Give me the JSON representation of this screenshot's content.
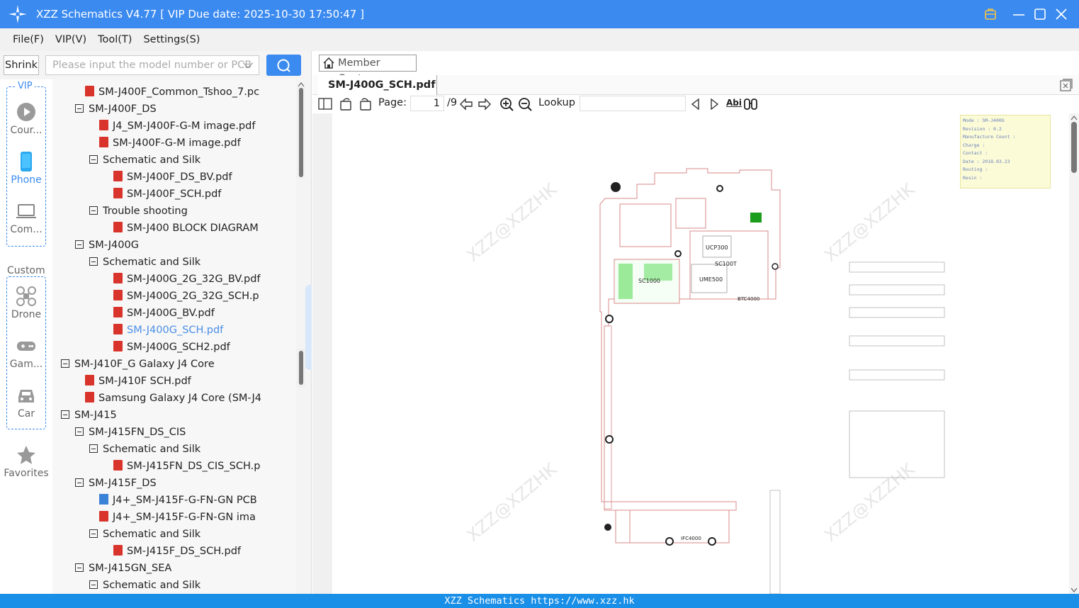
{
  "window": {
    "title": "XZZ Schematics V4.77 [ VIP Due date: 2025-10-30 17:50:47 ]"
  },
  "menu": [
    "File(F)",
    "VIP(V)",
    "Tool(T)",
    "Settings(S)"
  ],
  "left": {
    "shrink_label": "Shrink",
    "search_placeholder": "Please input the model number or PCB",
    "vip_label": "VIP",
    "custom_label": "Custom",
    "categories": [
      "Cour...",
      "Phone",
      "Com...",
      "Drone",
      "Gam...",
      "Car",
      "Favorites"
    ]
  },
  "tree": [
    {
      "label": "SM-J400F_Common_Tshoo_7.pc",
      "type": "pdf",
      "level": 1
    },
    {
      "label": "SM-J400F_DS",
      "type": "folder",
      "level": 1
    },
    {
      "label": "J4_SM-J400F-G-M image.pdf",
      "type": "pdf",
      "level": 2
    },
    {
      "label": "SM-J400F-G-M image.pdf",
      "type": "pdf",
      "level": 2
    },
    {
      "label": "Schematic and Silk",
      "type": "folder",
      "level": 2
    },
    {
      "label": "SM-J400F_DS_BV.pdf",
      "type": "pdf",
      "level": 3
    },
    {
      "label": "SM-J400F_SCH.pdf",
      "type": "pdf",
      "level": 3
    },
    {
      "label": "Trouble shooting",
      "type": "folder",
      "level": 2
    },
    {
      "label": "SM-J400 BLOCK DIAGRAM",
      "type": "pdf",
      "level": 3
    },
    {
      "label": "SM-J400G",
      "type": "folder",
      "level": 1
    },
    {
      "label": "Schematic and Silk",
      "type": "folder",
      "level": 2
    },
    {
      "label": "SM-J400G_2G_32G_BV.pdf",
      "type": "pdf",
      "level": 3
    },
    {
      "label": "SM-J400G_2G_32G_SCH.p",
      "type": "pdf",
      "level": 3
    },
    {
      "label": "SM-J400G_BV.pdf",
      "type": "pdf",
      "level": 3
    },
    {
      "label": "SM-J400G_SCH.pdf",
      "type": "pdf",
      "level": 3,
      "selected": true
    },
    {
      "label": "SM-J400G_SCH2.pdf",
      "type": "pdf",
      "level": 3
    },
    {
      "label": "SM-J410F_G Galaxy J4 Core",
      "type": "folder",
      "level": 0
    },
    {
      "label": "SM-J410F SCH.pdf",
      "type": "pdf",
      "level": 1
    },
    {
      "label": "Samsung Galaxy J4 Core (SM-J4",
      "type": "pdf",
      "level": 1
    },
    {
      "label": "SM-J415",
      "type": "folder",
      "level": 0
    },
    {
      "label": "SM-J415FN_DS_CIS",
      "type": "folder",
      "level": 1
    },
    {
      "label": "Schematic and Silk",
      "type": "folder",
      "level": 2
    },
    {
      "label": "SM-J415FN_DS_CIS_SCH.p",
      "type": "pdf",
      "level": 3
    },
    {
      "label": "SM-J415F_DS",
      "type": "folder",
      "level": 1
    },
    {
      "label": "J4+_SM-J415F-G-FN-GN PCB",
      "type": "pcb",
      "level": 2
    },
    {
      "label": "J4+_SM-J415F-G-FN-GN ima",
      "type": "pdf",
      "level": 2
    },
    {
      "label": "Schematic and Silk",
      "type": "folder",
      "level": 2
    },
    {
      "label": "SM-J415F_DS_SCH.pdf",
      "type": "pdf",
      "level": 3
    },
    {
      "label": "SM-J415GN_SEA",
      "type": "folder",
      "level": 1
    },
    {
      "label": "Schematic and Silk",
      "type": "folder",
      "level": 2
    }
  ],
  "right": {
    "member_center": "Member Center",
    "tab_title": "SM-J400G_SCH.pdf",
    "toolbar": {
      "page_label": "Page:",
      "page_value": "1",
      "page_total": "/9",
      "lookup_label": "Lookup",
      "abi": "Abi"
    },
    "info_box": [
      "Mode : SM-J400G",
      "Revision : 0.2",
      "Manufacture Count :",
      "Charge :",
      "Contact :",
      "Date : 2018.03.23",
      "Routing :",
      "Resin :"
    ],
    "component_labels": [
      "UCP300",
      "SC100T",
      "UME500",
      "SC1000",
      "BTC4000",
      "IFC4000"
    ],
    "watermark": "XZZ@XZZHK"
  },
  "footer": "XZZ Schematics https://www.xzz.hk",
  "colors": {
    "accent": "#3b8af0",
    "footer": "#1a8fe8",
    "pdf_icon": "#d8342c",
    "selected_text": "#4a8ee6",
    "pcb_outline": "#d98a8a",
    "component_green": "#2bd02b"
  }
}
